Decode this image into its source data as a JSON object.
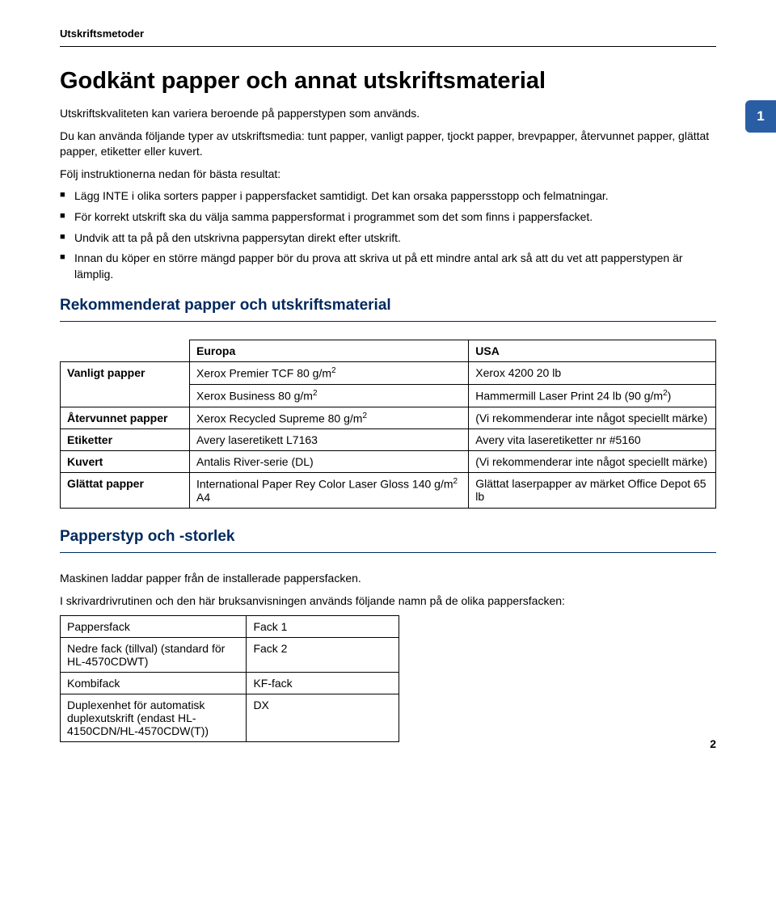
{
  "header": "Utskriftsmetoder",
  "tab_number": "1",
  "title": "Godkänt papper och annat utskriftsmaterial",
  "intro1": "Utskriftskvaliteten kan variera beroende på papperstypen som används.",
  "intro2": "Du kan använda följande typer av utskriftsmedia: tunt papper, vanligt papper, tjockt papper, brevpapper, återvunnet papper, glättat papper, etiketter eller kuvert.",
  "intro3": "Följ instruktionerna nedan för bästa resultat:",
  "bullets": [
    "Lägg INTE i olika sorters papper i pappersfacket samtidigt. Det kan orsaka pappersstopp och felmatningar.",
    "För korrekt utskrift ska du välja samma pappersformat i programmet som det som finns i pappersfacket.",
    "Undvik att ta på på den utskrivna pappersytan direkt efter utskrift.",
    "Innan du köper en större mängd papper bör du prova att skriva ut på ett mindre antal ark så att du vet att papperstypen är lämplig."
  ],
  "h2_reco": "Rekommenderat papper och utskriftsmaterial",
  "reco_table": {
    "col_eu": "Europa",
    "col_us": "USA",
    "rows": [
      {
        "label": "Vanligt papper",
        "eu": "Xerox Premier TCF 80 g/m",
        "eu_sup": "2",
        "us": "Xerox 4200 20 lb"
      },
      {
        "label": "",
        "eu": "Xerox Business 80 g/m",
        "eu_sup": "2",
        "us": "Hammermill Laser Print 24 lb (90 g/m",
        "us_sup": "2",
        "us_tail": ")"
      },
      {
        "label": "Återvunnet papper",
        "eu": "Xerox Recycled Supreme 80 g/m",
        "eu_sup": "2",
        "us": "(Vi rekommenderar inte något speciellt märke)"
      },
      {
        "label": "Etiketter",
        "eu": "Avery laseretikett L7163",
        "us": "Avery vita laseretiketter nr #5160"
      },
      {
        "label": "Kuvert",
        "eu": "Antalis River-serie (DL)",
        "us": "(Vi rekommenderar inte något speciellt märke)"
      },
      {
        "label": "Glättat papper",
        "eu": "International Paper Rey Color Laser Gloss 140 g/m",
        "eu_sup": "2",
        "eu_tail": " A4",
        "us": "Glättat laserpapper av märket Office Depot 65 lb"
      }
    ]
  },
  "h2_type": "Papperstyp och -storlek",
  "type_p1": "Maskinen laddar papper från de installerade pappersfacken.",
  "type_p2": "I skrivardrivrutinen och den här bruksanvisningen används följande namn på de olika pappersfacken:",
  "tray_table": [
    {
      "a": "Pappersfack",
      "b": "Fack 1"
    },
    {
      "a": "Nedre fack (tillval) (standard för HL-4570CDWT)",
      "b": "Fack 2"
    },
    {
      "a": "Kombifack",
      "b": "KF-fack"
    },
    {
      "a": "Duplexenhet för automatisk duplexutskrift (endast HL-4150CDN/HL-4570CDW(T))",
      "b": "DX"
    }
  ],
  "page_number": "2"
}
